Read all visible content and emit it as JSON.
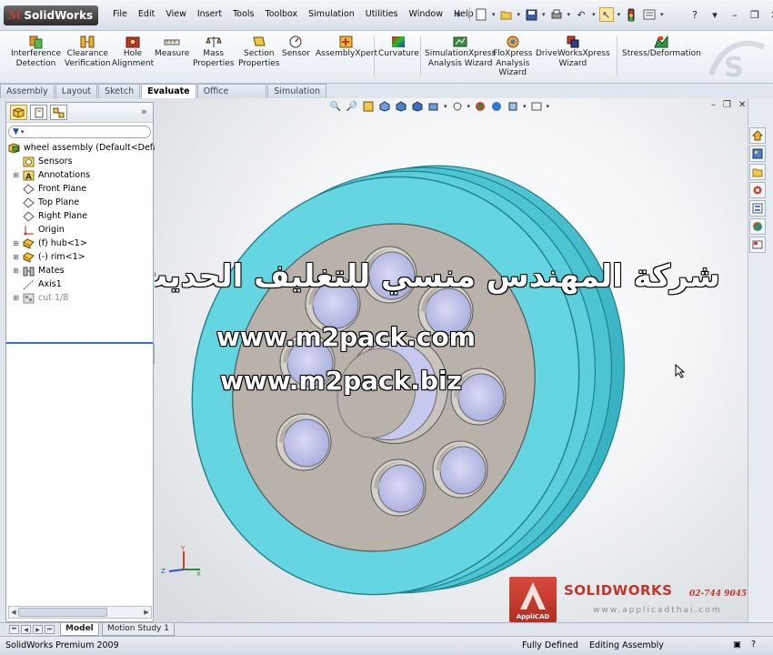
{
  "app": {
    "logo_text": "SolidWorks",
    "status_product": "SolidWorks Premium 2009"
  },
  "menu": [
    "File",
    "Edit",
    "View",
    "Insert",
    "Tools",
    "Toolbox",
    "Simulation",
    "Utilities",
    "Window",
    "Help"
  ],
  "commands": [
    {
      "label": "Interference\nDetection"
    },
    {
      "label": "Clearance\nVerification"
    },
    {
      "label": "Hole\nAlignment"
    },
    {
      "label": "Measure"
    },
    {
      "label": "Mass\nProperties"
    },
    {
      "label": "Section\nProperties"
    },
    {
      "label": "Sensor"
    },
    {
      "label": "AssemblyXpert"
    },
    {
      "label": "Curvature"
    },
    {
      "label": "SimulationXpress\nAnalysis Wizard"
    },
    {
      "label": "FloXpress\nAnalysis\nWizard"
    },
    {
      "label": "DriveWorksXpress\nWizard"
    },
    {
      "label": "Stress/Deformation"
    }
  ],
  "tabs": [
    {
      "label": "Assembly",
      "active": false
    },
    {
      "label": "Layout",
      "active": false
    },
    {
      "label": "Sketch",
      "active": false
    },
    {
      "label": "Evaluate",
      "active": true
    },
    {
      "label": "Office Products",
      "active": false
    },
    {
      "label": "Simulation",
      "active": false
    }
  ],
  "tree": [
    {
      "label": "wheel assembly  (Default<Default",
      "icon": "assembly-icon",
      "expander": "none",
      "root": true
    },
    {
      "label": "Sensors",
      "icon": "sensor-icon",
      "expander": "none"
    },
    {
      "label": "Annotations",
      "icon": "annotation-icon",
      "expander": "plus"
    },
    {
      "label": "Front Plane",
      "icon": "plane-icon",
      "expander": "none"
    },
    {
      "label": "Top Plane",
      "icon": "plane-icon",
      "expander": "none"
    },
    {
      "label": "Right Plane",
      "icon": "plane-icon",
      "expander": "none"
    },
    {
      "label": "Origin",
      "icon": "origin-icon",
      "expander": "none"
    },
    {
      "label": "(f) hub<1>",
      "icon": "part-icon",
      "expander": "plus"
    },
    {
      "label": "(-) rim<1>",
      "icon": "part-icon",
      "expander": "plus"
    },
    {
      "label": "Mates",
      "icon": "mates-icon",
      "expander": "plus"
    },
    {
      "label": "Axis1",
      "icon": "axis-icon",
      "expander": "none"
    },
    {
      "label": "cut 1/8",
      "icon": "pattern-icon",
      "expander": "plus",
      "gray": true
    }
  ],
  "watermark": {
    "arabic": "شركة المهندس منسي للتغليف الحديث",
    "url1": "www.m2pack.com",
    "url2": "www.m2pack.biz"
  },
  "brand": {
    "applicad": "AppliCAD",
    "solidworks": "SOLIDWORKS",
    "phone": "02-744 9045",
    "website": "www.applicadthai.com"
  },
  "bottom_tabs": [
    {
      "label": "Model",
      "active": true
    },
    {
      "label": "Motion Study 1",
      "active": false
    }
  ],
  "status": {
    "defined": "Fully Defined",
    "mode": "Editing Assembly"
  },
  "colors": {
    "rim": "#5fd4e0",
    "hub": "#b9b2aa",
    "hole": "#bfc2ea",
    "viewport_bg": "#f3f5f7"
  }
}
